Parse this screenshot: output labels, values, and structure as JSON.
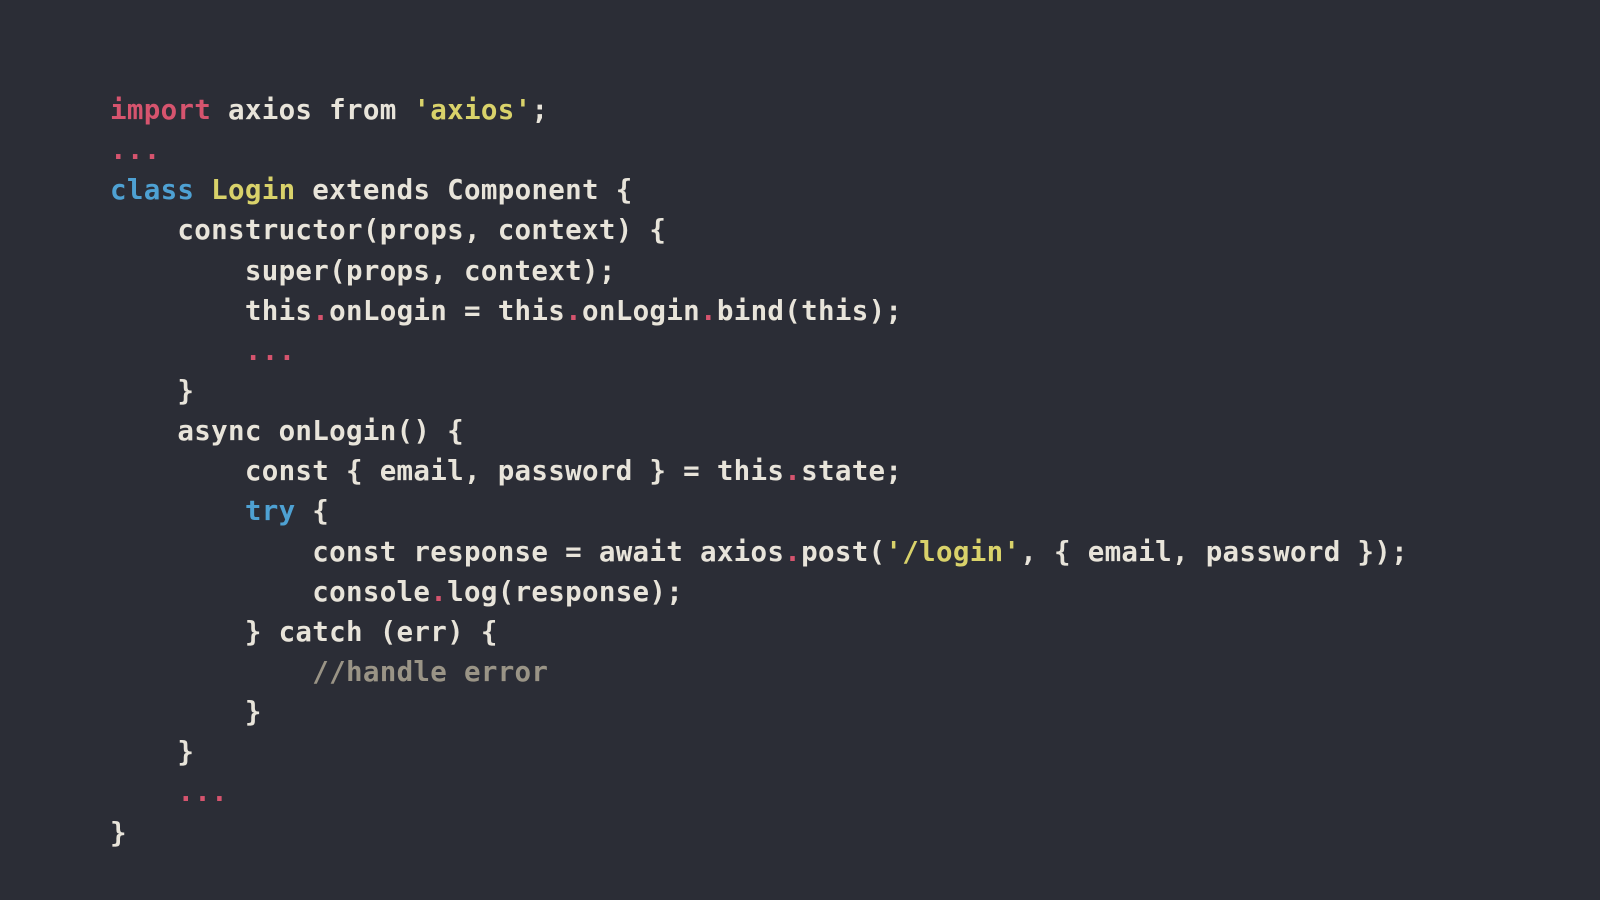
{
  "code": {
    "l1_import": "import",
    "l1_axios": " axios ",
    "l1_from": "from ",
    "l1_q1": "'",
    "l1_str": "axios",
    "l1_q2": "'",
    "l1_semi": ";",
    "l2_ellipsis": "...",
    "l3_class": "class",
    "l3_sp1": " ",
    "l3_name": "Login",
    "l3_rest": " extends Component {",
    "l4": "    constructor(props, context) {",
    "l5": "        super(props, context);",
    "l6_a": "        this",
    "l6_dot1": ".",
    "l6_b": "onLogin = this",
    "l6_dot2": ".",
    "l6_c": "onLogin",
    "l6_dot3": ".",
    "l6_d": "bind(this);",
    "l7_pad": "        ",
    "l7_ellipsis": "...",
    "l8": "    }",
    "l9": "    async onLogin() {",
    "l10_a": "        const { email, password } = this",
    "l10_dot": ".",
    "l10_b": "state;",
    "l11_pad": "        ",
    "l11_try": "try",
    "l11_rest": " {",
    "l12_a": "            const response = await axios",
    "l12_dot": ".",
    "l12_b": "post(",
    "l12_q1": "'",
    "l12_str": "/login",
    "l12_q2": "'",
    "l12_c": ", { email, password });",
    "l13_a": "            console",
    "l13_dot": ".",
    "l13_b": "log(response);",
    "l14": "        } catch (err) {",
    "l15_pad": "            ",
    "l15_comment": "//handle error",
    "l16": "        }",
    "l17": "    }",
    "l18_pad": "    ",
    "l18_ellipsis": "...",
    "l19": "}"
  }
}
